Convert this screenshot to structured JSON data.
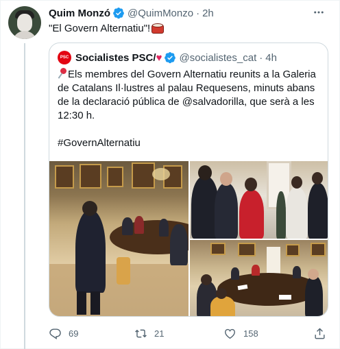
{
  "tweet": {
    "author_name": "Quim Monzó",
    "author_handle": "@QuimMonzo",
    "time": "2h",
    "separator": "·",
    "text": "\"El Govern Alternatiu\"!"
  },
  "quote": {
    "author_name": "Socialistes PSC/",
    "heart": "♥",
    "author_handle": "@socialistes_cat",
    "time": "4h",
    "separator": "·",
    "logo_text": "PSC",
    "lines": [
      "Els membres del Govern Alternatiu reunits a la Galeria",
      "de Catalans Il·lustres al palau Requesens, minuts abans",
      "de la declaració pública de @salvadorilla, que serà a les",
      "12:30 h."
    ],
    "hashtag": "#GovernAlternatiu"
  },
  "actions": {
    "replies": "69",
    "retweets": "21",
    "likes": "158"
  },
  "icons": {
    "verified": "verified-badge-icon",
    "more": "more-icon",
    "reply": "reply-icon",
    "retweet": "retweet-icon",
    "like": "heart-icon",
    "share": "share-icon"
  },
  "colors": {
    "verified": "#1d9bf0",
    "psc_red": "#e30613",
    "muted": "#536471",
    "border": "#cfd9de"
  }
}
